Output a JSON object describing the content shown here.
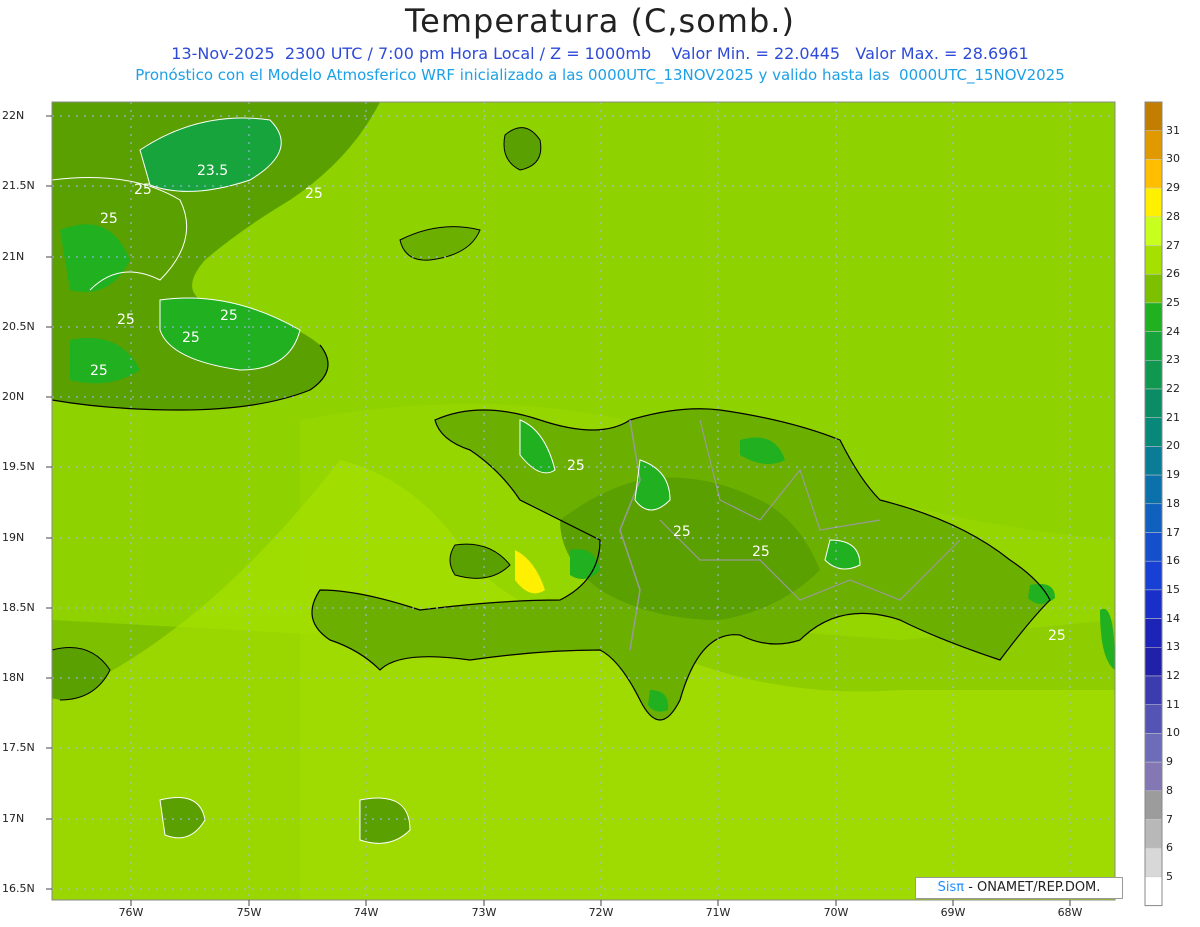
{
  "header": {
    "title": "Temperatura (C,somb.)",
    "subtitle_line1": "13-Nov-2025  2300 UTC / 7:00 pm Hora Local / Z = 1000mb    Valor Min. = 22.0445   Valor Max. = 28.6961",
    "subtitle_line2": "Pronóstico con el Modelo Atmosferico WRF inicializado a las 0000UTC_13NOV2025 y valido hasta las  0000UTC_15NOV2025"
  },
  "axes": {
    "lat_labels": [
      "22N",
      "21.5N",
      "21N",
      "20.5N",
      "20N",
      "19.5N",
      "19N",
      "18.5N",
      "18N",
      "17.5N",
      "17N",
      "16.5N"
    ],
    "lon_labels": [
      "76W",
      "75W",
      "74W",
      "73W",
      "72W",
      "71W",
      "70W",
      "69W",
      "68W"
    ]
  },
  "contour_labels": [
    "23.5",
    "25",
    "25",
    "25",
    "25",
    "25",
    "25",
    "25",
    "25",
    "25",
    "25",
    "25"
  ],
  "colorbar": {
    "levels": [
      "31",
      "30",
      "29",
      "28",
      "27",
      "26",
      "25",
      "24",
      "23",
      "22",
      "21",
      "20",
      "19",
      "18",
      "17",
      "16",
      "15",
      "14",
      "13",
      "12",
      "11",
      "10",
      "9",
      "8",
      "7",
      "6",
      "5"
    ],
    "colors": [
      "#c27e00",
      "#e09a00",
      "#ffbf00",
      "#ffef00",
      "#c8ff1e",
      "#a6e000",
      "#7dc000",
      "#20b020",
      "#18a43c",
      "#109850",
      "#0b8c64",
      "#088878",
      "#0a7c96",
      "#0c70aa",
      "#1060be",
      "#1450cc",
      "#1840d4",
      "#1830c8",
      "#1c24b8",
      "#2020a8",
      "#3c3cb0",
      "#5454b4",
      "#6c6cb8",
      "#8478b4",
      "#9c9c9c",
      "#b8b8b8",
      "#d8d8d8",
      "#ffffff"
    ]
  },
  "credit": {
    "sis": "Sisπ",
    "org": " - ONAMET/REP.DOM."
  }
}
